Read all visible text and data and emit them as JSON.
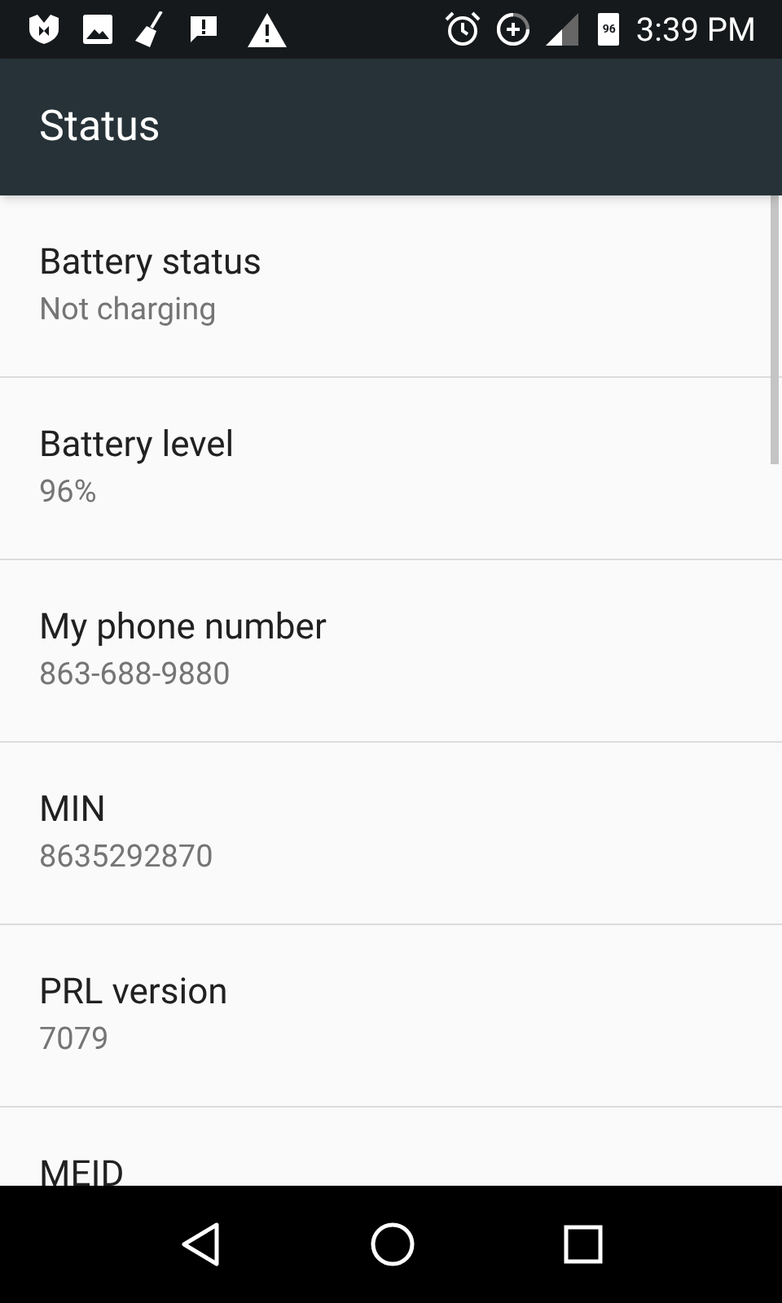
{
  "status_bar": {
    "battery_text": "96",
    "time": "3:39 PM"
  },
  "app_bar": {
    "title": "Status"
  },
  "items": [
    {
      "title": "Battery status",
      "summary": "Not charging"
    },
    {
      "title": "Battery level",
      "summary": "96%"
    },
    {
      "title": "My phone number",
      "summary": "863-688-9880"
    },
    {
      "title": "MIN",
      "summary": "8635292870"
    },
    {
      "title": "PRL version",
      "summary": "7079"
    },
    {
      "title": "MEID"
    }
  ]
}
